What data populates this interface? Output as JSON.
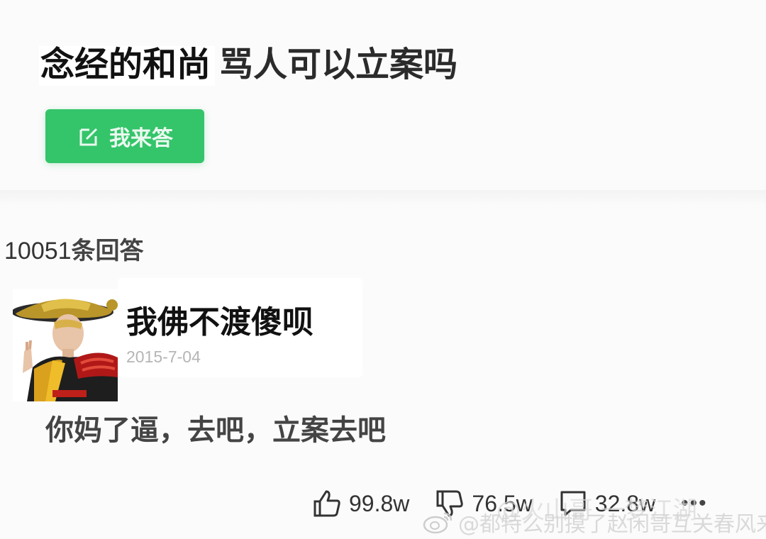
{
  "question": {
    "title_part1": "念经的和尚",
    "title_part2": "骂人可以立案吗"
  },
  "answer_button": {
    "label": "我来答",
    "button_color": "#34c46a"
  },
  "answers_section": {
    "count": "10051",
    "count_label": "条回答"
  },
  "answer": {
    "username": "我佛不渡傻呗",
    "date": "2015-7-04",
    "text": "你妈了逼，去吧，立案去吧",
    "likes": "99.8w",
    "dislikes": "76.5w",
    "comments": "32.8w",
    "more_label": "•••"
  },
  "watermarks": {
    "line1": "@火山哥",
    "line2": "@都特么别摸了赵闲哥互关春风来",
    "corner": "一梦江湖"
  },
  "icons": {
    "edit": "edit-icon",
    "like": "thumbs-up-icon",
    "dislike": "thumbs-down-icon",
    "comment": "comment-icon",
    "weibo": "weibo-icon"
  }
}
